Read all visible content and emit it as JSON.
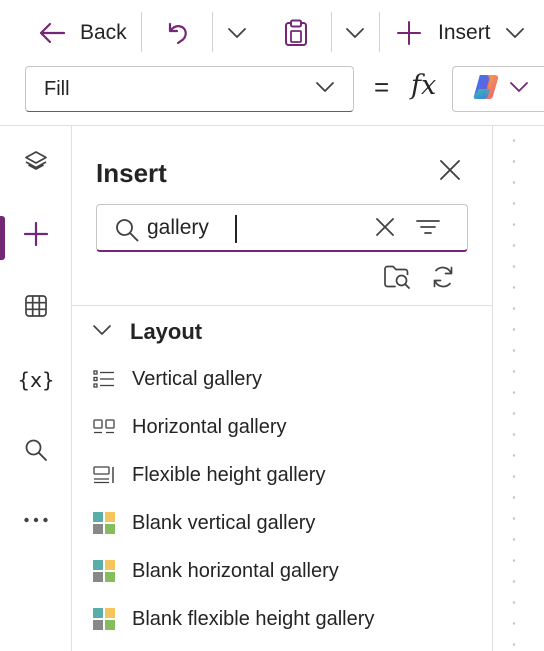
{
  "toolbar": {
    "back_label": "Back",
    "insert_label": "Insert"
  },
  "formula_bar": {
    "property_value": "Fill",
    "equals_symbol": "=",
    "fx_symbol": "fx"
  },
  "insert_panel": {
    "title": "Insert",
    "search": {
      "value": "gallery",
      "placeholder": "Search"
    },
    "group": {
      "label": "Layout",
      "items": [
        {
          "label": "Vertical gallery",
          "icon": "vertical-gallery-icon"
        },
        {
          "label": "Horizontal gallery",
          "icon": "horizontal-gallery-icon"
        },
        {
          "label": "Flexible height gallery",
          "icon": "flexible-height-gallery-icon"
        },
        {
          "label": "Blank vertical gallery",
          "icon": "blank-gallery-icon"
        },
        {
          "label": "Blank horizontal gallery",
          "icon": "blank-gallery-icon"
        },
        {
          "label": "Blank flexible height gallery",
          "icon": "blank-gallery-icon"
        }
      ]
    }
  },
  "rail": {
    "variables_glyph": "{x}"
  },
  "colors": {
    "accent": "#742774",
    "text": "#242424",
    "border": "#e1dfdd",
    "tile_teal": "#5aaea8",
    "tile_yellow": "#f4c55c",
    "tile_gray": "#8a8886",
    "tile_green": "#84bd5d"
  }
}
